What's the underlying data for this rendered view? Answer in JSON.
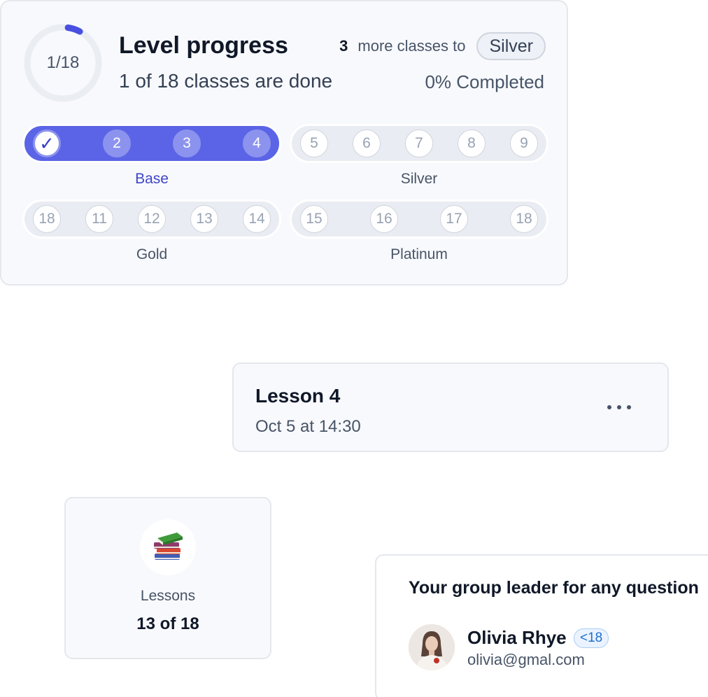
{
  "level_progress": {
    "ring_text": "1/18",
    "ring_fraction": 0.056,
    "title": "Level progress",
    "subtitle": "1 of 18 classes are done",
    "more_count": "3",
    "more_text": "more classes to",
    "next_tier": "Silver",
    "completed_text": "0% Completed",
    "tiers": [
      {
        "name": "Base",
        "active": true,
        "steps": [
          "✓",
          "2",
          "3",
          "4"
        ]
      },
      {
        "name": "Silver",
        "active": false,
        "steps": [
          "5",
          "6",
          "7",
          "8",
          "9"
        ]
      },
      {
        "name": "Gold",
        "active": false,
        "steps": [
          "18",
          "11",
          "12",
          "13",
          "14"
        ]
      },
      {
        "name": "Platinum",
        "active": false,
        "steps": [
          "15",
          "16",
          "17",
          "18"
        ]
      }
    ],
    "colors": {
      "accent": "#5b64e6",
      "accent_light": "#8c93ee",
      "active_label": "#3e45c8"
    }
  },
  "lesson": {
    "title": "Lesson 4",
    "date": "Oct 5 at 14:30",
    "menu_icon": "more-horizontal-icon"
  },
  "lessons_stat": {
    "icon": "books-icon",
    "label": "Lessons",
    "value": "13 of 18"
  },
  "group_leader": {
    "heading": "Your group leader for any question",
    "name": "Olivia Rhye",
    "badge": "<18",
    "email": "olivia@gmal.com"
  }
}
